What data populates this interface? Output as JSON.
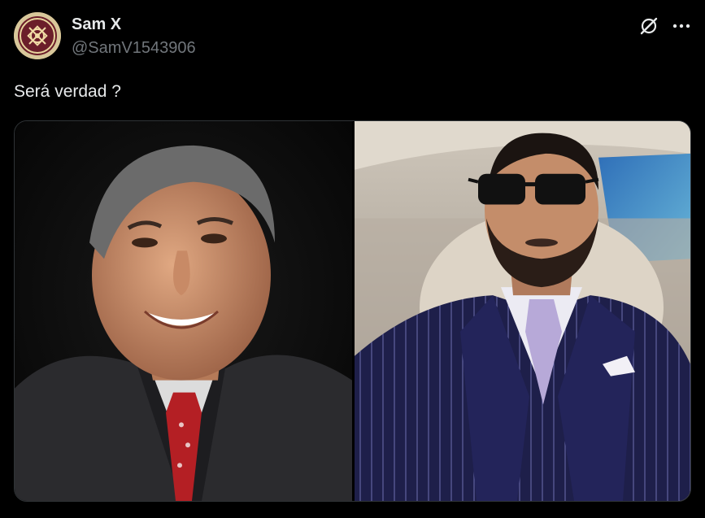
{
  "tweet": {
    "author_name": "Sam X",
    "author_handle": "@SamV1543906",
    "text": "Será verdad ?",
    "icons": {
      "avatar": "avatar",
      "grok": "grok-icon",
      "more": "more-icon"
    },
    "media": {
      "count": 2,
      "photos": [
        "photo-left",
        "photo-right"
      ]
    }
  },
  "colors": {
    "background": "#000000",
    "primary_text": "#e7e9ea",
    "secondary_text": "#71767b",
    "border": "#2f3336"
  }
}
